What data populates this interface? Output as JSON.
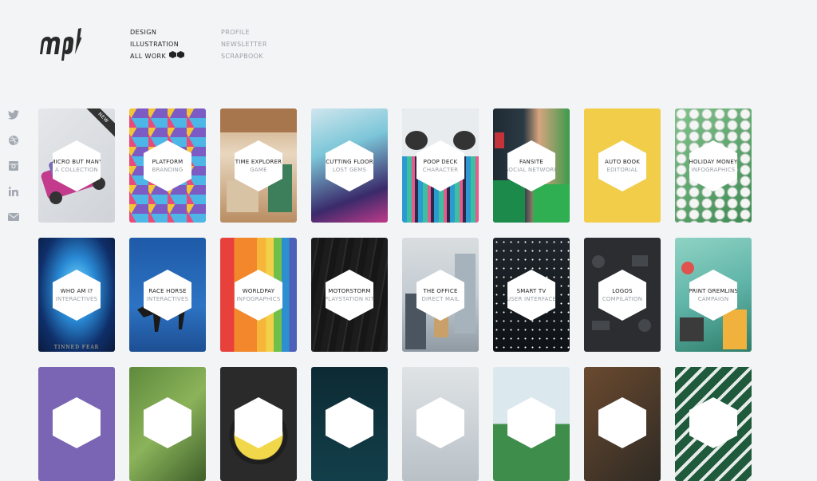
{
  "brand": {
    "logo_text": "mpb"
  },
  "nav": {
    "primary": [
      "DESIGN",
      "ILLUSTRATION",
      "ALL WORK"
    ],
    "secondary": [
      "PROFILE",
      "NEWSLETTER",
      "SCRAPBOOK"
    ]
  },
  "social": [
    {
      "icon": "twitter-icon"
    },
    {
      "icon": "dribbble-icon"
    },
    {
      "icon": "instagram-icon"
    },
    {
      "icon": "linkedin-icon"
    },
    {
      "icon": "email-icon"
    }
  ],
  "cards": [
    {
      "title": "MICRO BUT MANY",
      "subtitle": "A COLLECTION",
      "badge": "NEW"
    },
    {
      "title": "PLATFORM",
      "subtitle": "BRANDING"
    },
    {
      "title": "TIME EXPLORER",
      "subtitle": "GAME"
    },
    {
      "title": "CUTTING FLOOR",
      "subtitle": "LOST GEMS"
    },
    {
      "title": "POOP DECK",
      "subtitle": "CHARACTER"
    },
    {
      "title": "FANSITE",
      "subtitle": "SOCIAL NETWORK"
    },
    {
      "title": "AUTO BOOK",
      "subtitle": "EDITORIAL"
    },
    {
      "title": "HOLIDAY MONEY",
      "subtitle": "INFOGRAPHICS"
    },
    {
      "title": "WHO AM I?",
      "subtitle": "INTERACTIVES",
      "caption": "TINNED FEAR"
    },
    {
      "title": "RACE HORSE",
      "subtitle": "INTERACTIVES"
    },
    {
      "title": "WORLDPAY",
      "subtitle": "INFOGRAPHICS"
    },
    {
      "title": "MOTORSTORM",
      "subtitle": "PLAYSTATION KIT"
    },
    {
      "title": "THE OFFICE",
      "subtitle": "DIRECT MAIL"
    },
    {
      "title": "SMART TV",
      "subtitle": "USER INTERFACE"
    },
    {
      "title": "LOGOS",
      "subtitle": "COMPILATION"
    },
    {
      "title": "PRINT GREMLINS",
      "subtitle": "CAMPAIGN"
    }
  ],
  "colors": {
    "background": "#f3f4f6",
    "text": "#222222",
    "muted": "#9a9ea5",
    "auto_book_yellow": "#f2cd4a",
    "purple": "#7a64b4"
  }
}
